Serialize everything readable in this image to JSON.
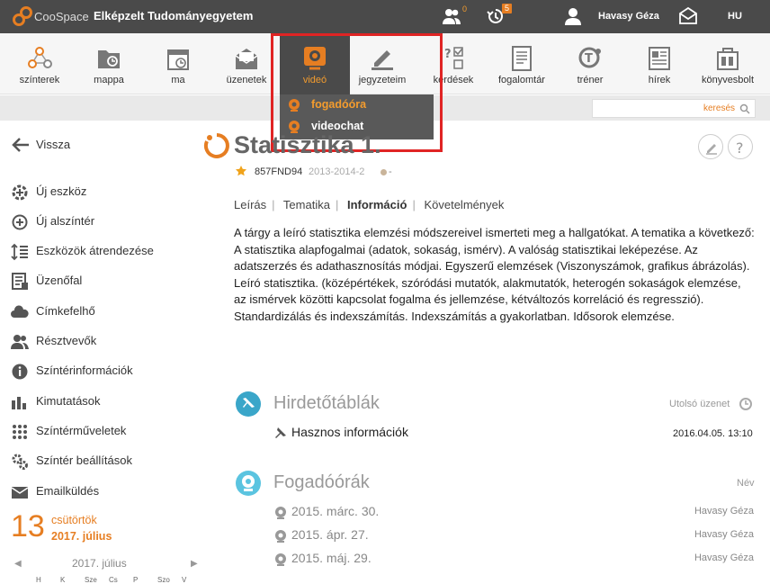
{
  "colors": {
    "accent": "#e67e22",
    "topbar": "#4a4a4a",
    "highlight": "#e02424",
    "teal": "#3aa6c9"
  },
  "topbar": {
    "logo_text": "CooSpace",
    "org_title": "Elképzelt Tudományegyetem",
    "people_badge": "0",
    "history_badge": "5",
    "user_name": "Havasy Géza",
    "language": "HU"
  },
  "toolbar": {
    "items": [
      {
        "label": "színterek",
        "icon": "network-icon"
      },
      {
        "label": "mappa",
        "icon": "folder-icon"
      },
      {
        "label": "ma",
        "icon": "calendar-today-icon"
      },
      {
        "label": "üzenetek",
        "icon": "envelope-icon"
      },
      {
        "label": "videó",
        "icon": "webcam-icon"
      },
      {
        "label": "jegyzeteim",
        "icon": "pencil-icon"
      },
      {
        "label": "kérdések",
        "icon": "quiz-icon"
      },
      {
        "label": "fogalomtár",
        "icon": "glossary-icon"
      },
      {
        "label": "tréner",
        "icon": "trainer-icon"
      },
      {
        "label": "hírek",
        "icon": "news-icon"
      },
      {
        "label": "könyvesbolt",
        "icon": "bookshop-icon"
      }
    ]
  },
  "video_menu": {
    "items": [
      {
        "label": "fogadóóra"
      },
      {
        "label": "videochat"
      }
    ]
  },
  "search": {
    "placeholder": "keresés"
  },
  "sidebar": {
    "back_label": "Vissza",
    "items": [
      {
        "label": "Új eszköz"
      },
      {
        "label": "Új alszíntér"
      },
      {
        "label": "Eszközök átrendezése"
      },
      {
        "label": "Üzenőfal"
      },
      {
        "label": "Címkefelhő"
      },
      {
        "label": "Résztvevők"
      },
      {
        "label": "Színtérinformációk"
      },
      {
        "label": "Kimutatások"
      },
      {
        "label": "Színtérműveletek"
      },
      {
        "label": "Színtér beállítások"
      },
      {
        "label": "Emailküldés"
      }
    ],
    "date": {
      "day": "13",
      "weekday": "csütörtök",
      "month": "2017. július"
    },
    "calendar": {
      "title": "2017. július",
      "days": [
        "H",
        "K",
        "Sze",
        "Cs",
        "P",
        "Szo",
        "V"
      ]
    }
  },
  "course": {
    "title": "Statisztika 1.",
    "code": "857FND94",
    "semester": "2013-2014-2",
    "dash": "-",
    "tabs": [
      "Leírás",
      "Tematika",
      "Információ",
      "Követelmények"
    ],
    "description": "A tárgy a leíró statisztika elemzési módszereivel ismerteti meg a hallgatókat.  A tematika a következő: A statisztika alapfogalmai (adatok, sokaság, ismérv). A valóság statisztikai leképezése. Az adatszerzés és adathasznosítás módjai. Egyszerű elemzések (Viszonyszámok, grafikus ábrázolás). Leíró statisztika. (középértékek, szóródási mutatók, alakmutatók, heterogén sokaságok elemzése, az ismérvek közötti kapcsolat fogalma és jellemzése, kétváltozós korreláció és regresszió). Standardizálás és indexszámítás. Indexszámítás a gyakorlatban. Idősorok elemzése."
  },
  "noticeboards": {
    "title": "Hirdetőtáblák",
    "meta": "Utolsó üzenet",
    "item_label": "Hasznos információk",
    "item_date": "2016.04.05. 13:10"
  },
  "office_hours": {
    "title": "Fogadóórák",
    "meta": "Név",
    "rows": [
      {
        "date": "2015. márc. 30.",
        "name": "Havasy Géza"
      },
      {
        "date": "2015. ápr. 27.",
        "name": "Havasy Géza"
      },
      {
        "date": "2015. máj. 29.",
        "name": "Havasy Géza"
      }
    ]
  }
}
